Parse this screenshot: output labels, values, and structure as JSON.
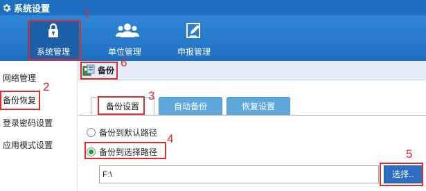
{
  "window": {
    "title": "系统设置",
    "icon": "gear-icon"
  },
  "topnav": {
    "items": [
      {
        "label": "系统管理",
        "icon": "lock-icon",
        "active": true
      },
      {
        "label": "单位管理",
        "icon": "users-icon",
        "active": false
      },
      {
        "label": "申报管理",
        "icon": "edit-icon",
        "active": false
      }
    ]
  },
  "sidebar": {
    "items": [
      {
        "label": "网络管理",
        "active": false
      },
      {
        "label": "备份恢复",
        "active": true
      },
      {
        "label": "登录密码设置",
        "active": false
      },
      {
        "label": "应用模式设置",
        "active": false
      }
    ]
  },
  "breadcrumb": {
    "label": "备份",
    "icon": "backup-icon"
  },
  "tabs": [
    {
      "label": "备份设置",
      "active": true
    },
    {
      "label": "自动备份",
      "active": false
    },
    {
      "label": "恢复设置",
      "active": false
    }
  ],
  "backup": {
    "options": [
      {
        "label": "备份到默认路径",
        "checked": false
      },
      {
        "label": "备份到选择路径",
        "checked": true
      }
    ],
    "path_value": "F:\\",
    "choose_label": "选择.."
  },
  "annotations": [
    "1",
    "2",
    "3",
    "4",
    "5",
    "6"
  ],
  "colors": {
    "accent": "#1f6fc1",
    "annotation": "#e52828",
    "radio_checked": "#1ea31e"
  }
}
